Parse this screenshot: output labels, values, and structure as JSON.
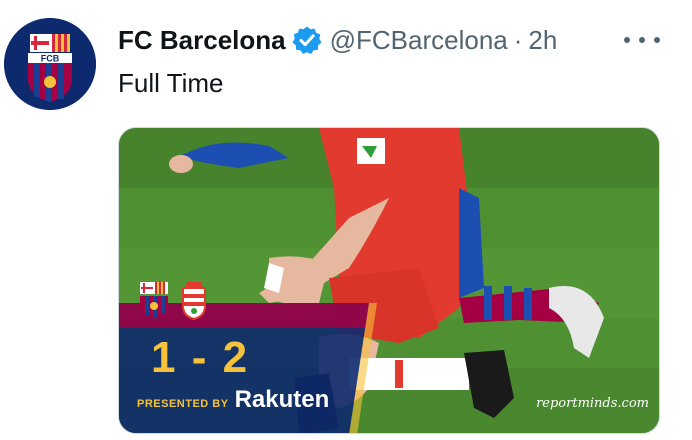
{
  "tweet": {
    "author_name": "FC Barcelona",
    "handle": "@FCBarcelona",
    "separator": "·",
    "time": "2h",
    "text": "Full Time",
    "verified": true,
    "more_icon": "more-horizontal-icon"
  },
  "avatar": {
    "icon": "fc-barcelona-crest-icon",
    "crest_letters": "FCB"
  },
  "media": {
    "home_crest": "fc-barcelona-crest-icon",
    "away_crest": "granada-crest-icon",
    "score": "1 - 2",
    "presented_by": "PRESENTED BY",
    "sponsor": "Rakuten",
    "watermark": "reportminds.com"
  },
  "colors": {
    "text_primary": "#0f1419",
    "text_secondary": "#536471",
    "verified_blue": "#1d9bf0",
    "barca_blue": "#0d2a6e",
    "barca_red": "#a50044",
    "score_gold": "#f6c23a",
    "pitch_green": "#4a8a2f",
    "granada_red": "#e23a2f"
  }
}
